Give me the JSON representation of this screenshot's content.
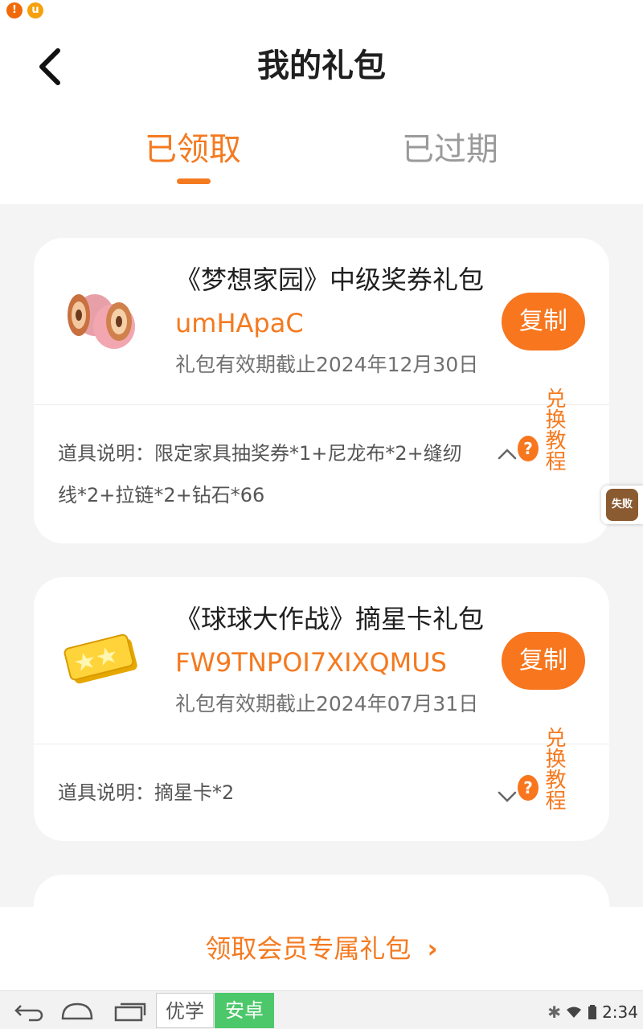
{
  "header": {
    "title": "我的礼包",
    "tabs": [
      {
        "label": "已领取",
        "active": true
      },
      {
        "label": "已过期",
        "active": false
      }
    ]
  },
  "gifts": [
    {
      "name": "《梦想家园》中级奖券礼包",
      "code": "umHApaC",
      "expire": "礼包有效期截止2024年12月30日",
      "copy_label": "复制",
      "description": "道具说明：限定家具抽奖券*1+尼龙布*2+缝纫线*2+拉链*2+钻石*66",
      "redeem_label": "兑换教程",
      "expanded": true,
      "icon": "thread-spool-icon"
    },
    {
      "name": "《球球大作战》摘星卡礼包",
      "code": "FW9TNPOI7XIXQMUS",
      "expire": "礼包有效期截止2024年07月31日",
      "copy_label": "复制",
      "description": "道具说明：摘星卡*2",
      "redeem_label": "兑换教程",
      "expanded": false,
      "icon": "star-ticket-icon"
    }
  ],
  "float_badge": {
    "label": "失败"
  },
  "footer": {
    "label": "领取会员专属礼包"
  },
  "system_bar": {
    "tag_youxue": "优学",
    "tag_anzhuo": "安卓",
    "time": "2:34"
  },
  "colors": {
    "accent": "#f47a20",
    "copy_button": "#f7761e",
    "background": "#f4f4f4"
  }
}
